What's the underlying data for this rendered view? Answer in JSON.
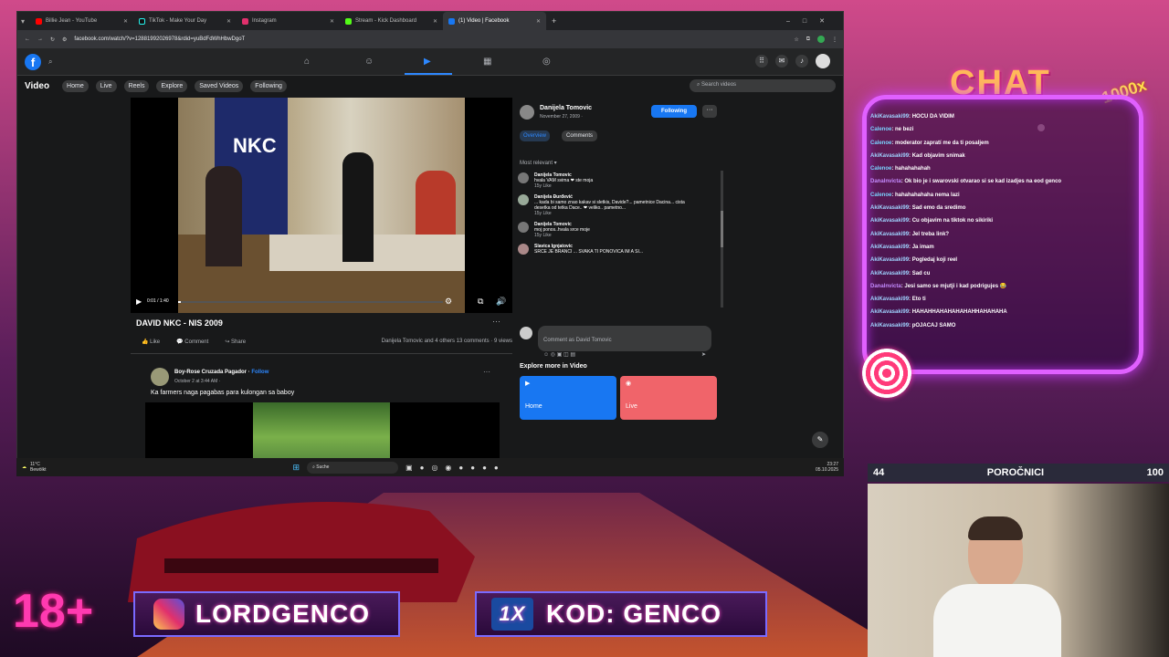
{
  "browser": {
    "tabs": [
      {
        "label": "Billie Jean - YouTube",
        "color": "#ff0000"
      },
      {
        "label": "TikTok - Make Your Day",
        "color": "#111111"
      },
      {
        "label": "Instagram",
        "color": "#e1306c"
      },
      {
        "label": "Stream - Kick Dashboard",
        "color": "#53fc18"
      },
      {
        "label": "(1) Video | Facebook",
        "color": "#1877f2"
      }
    ],
    "url": "facebook.com/watch/?v=12881992026978&rdid=yuBdFdWhHbwDgoT"
  },
  "fb": {
    "section_title": "Video",
    "nav": [
      "Home",
      "Live",
      "Reels",
      "Explore",
      "Saved Videos",
      "Following"
    ],
    "search_placeholder": "Search videos",
    "video": {
      "title": "DAVID NKC - NIS 2009",
      "time": "0:01 / 1:40",
      "sign_text": "NKC",
      "actions": {
        "like": "Like",
        "comment": "Comment",
        "share": "Share"
      },
      "reactions": "Danijela Tomovic and 4 others",
      "comments_count": "13 comments",
      "views": "9 views"
    },
    "poster": {
      "name": "Danijela Tomovic",
      "date": "November 27, 2009 · ",
      "follow_label": "Following"
    },
    "tabs": {
      "overview": "Overview",
      "comments": "Comments"
    },
    "sort": "Most relevant ▾",
    "comments": [
      {
        "name": "Danijela Tomovic",
        "text": "hvala VAM svima ❤ ste moja",
        "meta": "15y  Like"
      },
      {
        "name": "Danijela Đurđević",
        "text": "... kada bi samo znao kakav si sletkis, Davide?... pametnice Dacina... cista desetka od tetka Dace.. ❤ veliko.. pametno...",
        "meta": "15y  Like"
      },
      {
        "name": "Danijela Tomovic",
        "text": "moj ponos..hvala srce moje",
        "meta": "15y  Like"
      },
      {
        "name": "Slavica Ignjatovic",
        "text": "SRCE JE BRANCI ... SVAKA TI PONOVICA IM A SI...",
        "meta": ""
      }
    ],
    "comment_placeholder": "Comment as David Tomovic",
    "explore": {
      "title": "Explore more in Video",
      "home": "Home",
      "live": "Live"
    },
    "post": {
      "name": "Boy-Rose Cruzada Pagador",
      "follow": "Follow",
      "date": "October 2 at 3:44 AM · ",
      "text": "Ka farmers naga pagabas para kulongan sa baboy"
    }
  },
  "taskbar": {
    "weather_temp": "11°C",
    "weather_desc": "Bewölkt",
    "search": "Suche",
    "time": "23:27",
    "date": "05.10.2025"
  },
  "overlay": {
    "chat_title": "CHAT",
    "badge": "1000x",
    "chat": [
      {
        "user": "AkiKavasaki99",
        "msg": "HOCU DA VIDIM",
        "color": "#9fd3ff"
      },
      {
        "user": "Calenoe",
        "msg": "ne bezi",
        "color": "#7ad3ff"
      },
      {
        "user": "Calenoe",
        "msg": "moderator zapratí me da ti posaljem",
        "color": "#7ad3ff"
      },
      {
        "user": "AkiKavasaki99",
        "msg": "Kad objavim snimak",
        "color": "#9fd3ff"
      },
      {
        "user": "Calenoe",
        "msg": "hahahahahah",
        "color": "#7ad3ff"
      },
      {
        "user": "Danalnvicta",
        "msg": "Ok bio je i swarovski otvarao si se kad izadjes na eod genco",
        "color": "#c58bff"
      },
      {
        "user": "Calenoe",
        "msg": "hahahahahaha nema lazi",
        "color": "#7ad3ff"
      },
      {
        "user": "AkiKavasaki99",
        "msg": "Sad emo da sredimo",
        "color": "#9fd3ff"
      },
      {
        "user": "AkiKavasaki99",
        "msg": "Cu objavim na tiktok no sikiriki",
        "color": "#9fd3ff"
      },
      {
        "user": "AkiKavasaki99",
        "msg": "Jel treba link?",
        "color": "#9fd3ff"
      },
      {
        "user": "AkiKavasaki99",
        "msg": "Ja imam",
        "color": "#9fd3ff"
      },
      {
        "user": "AkiKavasaki99",
        "msg": "Pogledaj koji reel",
        "color": "#9fd3ff"
      },
      {
        "user": "AkiKavasaki99",
        "msg": "Sad cu",
        "color": "#9fd3ff"
      },
      {
        "user": "Danalnvicta",
        "msg": "Jesi samo se mjutji i kad podrigujes 😂",
        "color": "#c58bff"
      },
      {
        "user": "AkiKavasaki99",
        "msg": "Eto ti",
        "color": "#9fd3ff"
      },
      {
        "user": "AkiKavasaki99",
        "msg": "HAHAHHAHAHAHAHAHHAHAHAHA",
        "color": "#9fd3ff"
      },
      {
        "user": "AkiKavasaki99",
        "msg": "pOJACAJ SAMO",
        "color": "#9fd3ff"
      }
    ],
    "bar": {
      "left": "44",
      "center": "POROČNICI",
      "right": "100"
    },
    "age": "18+",
    "instagram": "LORDGENCO",
    "code": "KOD: GENCO",
    "code_logo": "1X"
  }
}
